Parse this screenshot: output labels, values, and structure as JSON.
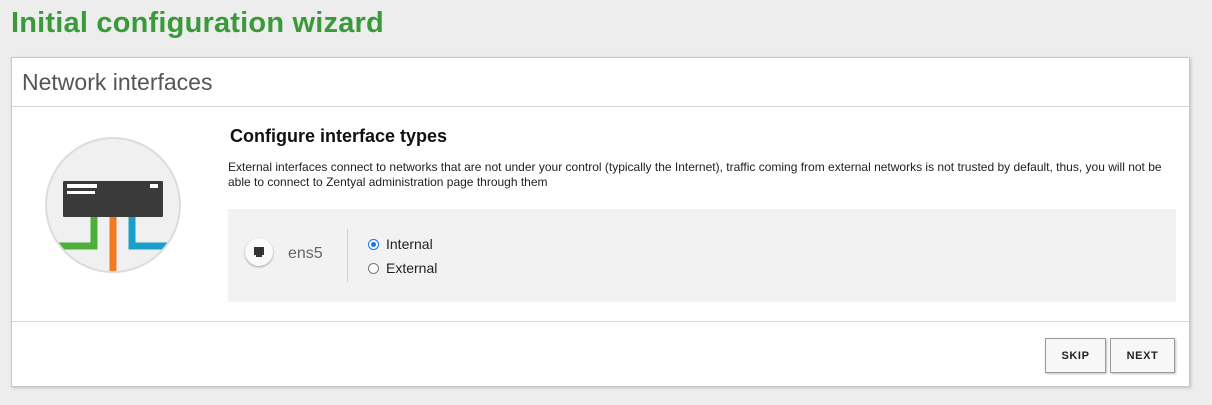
{
  "page": {
    "title": "Initial configuration wizard"
  },
  "panel": {
    "title": "Network interfaces"
  },
  "illustration": {
    "icon": "network-switch-icon",
    "colors": {
      "circle": "#f0f0f0",
      "device": "#3a3a3a",
      "cable_green": "#4caf3a",
      "cable_orange": "#f07b22",
      "cable_blue": "#1aa0c8"
    }
  },
  "section": {
    "title": "Configure interface types",
    "description": "External interfaces connect to networks that are not under your control (typically the Internet), traffic coming from external networks is not trusted by default, thus, you will not be able to connect to Zentyal administration page through them"
  },
  "interfaces": [
    {
      "icon": "ethernet-port-icon",
      "name": "ens5",
      "options": [
        {
          "label": "Internal",
          "checked": true
        },
        {
          "label": "External",
          "checked": false
        }
      ]
    }
  ],
  "buttons": {
    "skip": "SKIP",
    "next": "NEXT"
  },
  "colors": {
    "title_green": "#3a9a3a",
    "radio_accent": "#1a73e8",
    "background": "#ededed"
  }
}
